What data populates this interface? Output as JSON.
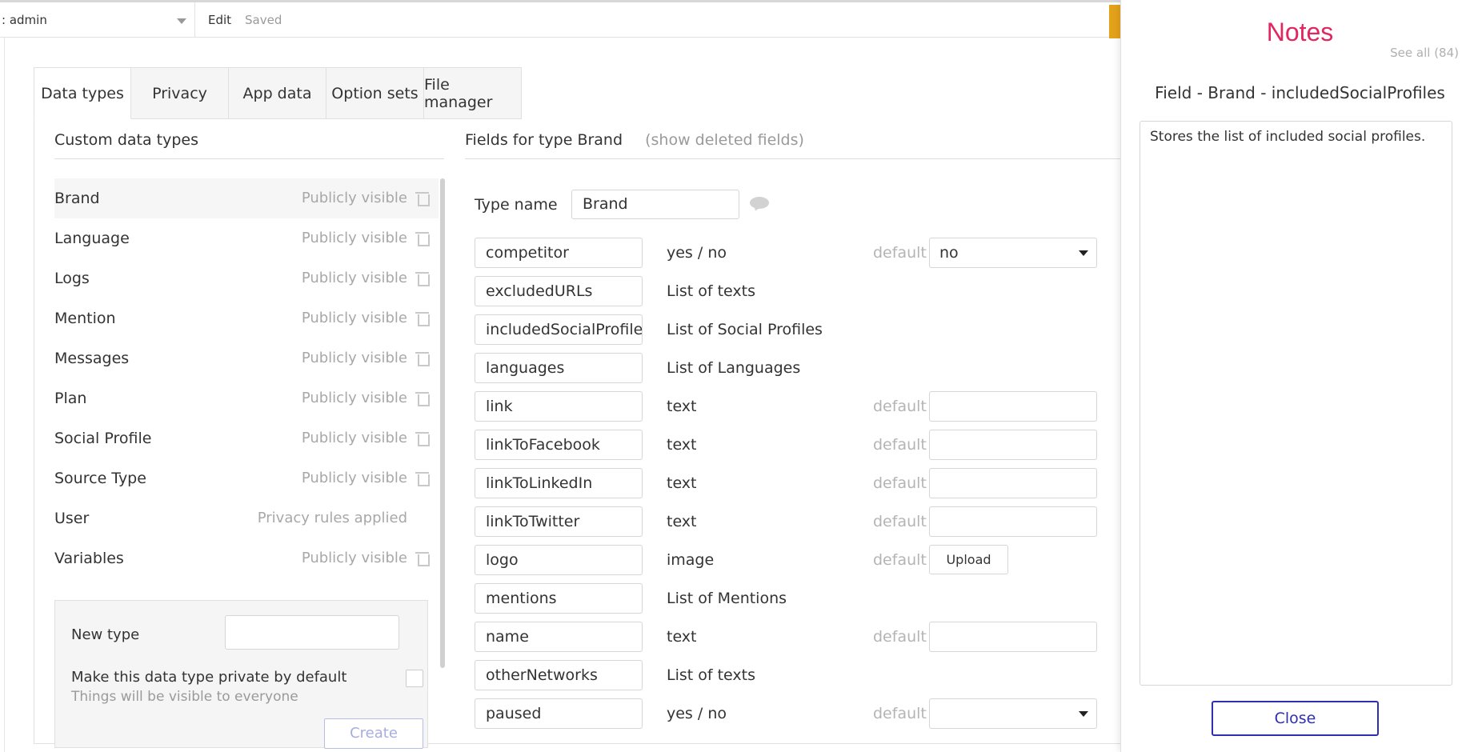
{
  "topbar": {
    "app_selector": ": admin",
    "edit_label": "Edit",
    "status_label": "Saved"
  },
  "tabs": [
    {
      "label": "Data types",
      "active": true
    },
    {
      "label": "Privacy",
      "active": false
    },
    {
      "label": "App data",
      "active": false
    },
    {
      "label": "Option sets",
      "active": false
    },
    {
      "label": "File manager",
      "active": false
    }
  ],
  "custom_types": {
    "header": "Custom data types",
    "items": [
      {
        "name": "Brand",
        "visibility": "Publicly visible",
        "selected": true,
        "deletable": true
      },
      {
        "name": "Language",
        "visibility": "Publicly visible",
        "selected": false,
        "deletable": true
      },
      {
        "name": "Logs",
        "visibility": "Publicly visible",
        "selected": false,
        "deletable": true
      },
      {
        "name": "Mention",
        "visibility": "Publicly visible",
        "selected": false,
        "deletable": true
      },
      {
        "name": "Messages",
        "visibility": "Publicly visible",
        "selected": false,
        "deletable": true
      },
      {
        "name": "Plan",
        "visibility": "Publicly visible",
        "selected": false,
        "deletable": true
      },
      {
        "name": "Social Profile",
        "visibility": "Publicly visible",
        "selected": false,
        "deletable": true
      },
      {
        "name": "Source Type",
        "visibility": "Publicly visible",
        "selected": false,
        "deletable": true
      },
      {
        "name": "User",
        "visibility": "Privacy rules applied",
        "selected": false,
        "deletable": false
      },
      {
        "name": "Variables",
        "visibility": "Publicly visible",
        "selected": false,
        "deletable": true
      }
    ],
    "new_type": {
      "label": "New type",
      "value": "",
      "private_label": "Make this data type private by default",
      "private_sub": "Things will be visible to everyone",
      "private_checked": false,
      "create_label": "Create"
    }
  },
  "fields_panel": {
    "header": "Fields for type Brand",
    "show_deleted": "(show deleted fields)",
    "type_name_label": "Type name",
    "type_name_value": "Brand",
    "default_label": "default",
    "upload_label": "Upload",
    "fields": [
      {
        "name": "competitor",
        "type": "yes / no",
        "default_kind": "dropdown",
        "default_value": "no"
      },
      {
        "name": "excludedURLs",
        "type": "List of texts",
        "default_kind": "none",
        "default_value": ""
      },
      {
        "name": "includedSocialProfiles",
        "type": "List of Social Profiles",
        "default_kind": "none",
        "default_value": ""
      },
      {
        "name": "languages",
        "type": "List of Languages",
        "default_kind": "none",
        "default_value": ""
      },
      {
        "name": "link",
        "type": "text",
        "default_kind": "text",
        "default_value": ""
      },
      {
        "name": "linkToFacebook",
        "type": "text",
        "default_kind": "text",
        "default_value": ""
      },
      {
        "name": "linkToLinkedIn",
        "type": "text",
        "default_kind": "text",
        "default_value": ""
      },
      {
        "name": "linkToTwitter",
        "type": "text",
        "default_kind": "text",
        "default_value": ""
      },
      {
        "name": "logo",
        "type": "image",
        "default_kind": "upload",
        "default_value": ""
      },
      {
        "name": "mentions",
        "type": "List of Mentions",
        "default_kind": "none",
        "default_value": ""
      },
      {
        "name": "name",
        "type": "text",
        "default_kind": "text",
        "default_value": ""
      },
      {
        "name": "otherNetworks",
        "type": "List of texts",
        "default_kind": "none",
        "default_value": ""
      },
      {
        "name": "paused",
        "type": "yes / no",
        "default_kind": "dropdown",
        "default_value": ""
      }
    ]
  },
  "notes": {
    "title": "Notes",
    "see_all": "See all (84)",
    "field_title": "Field - Brand - includedSocialProfiles",
    "body": "Stores the list of included social profiles.",
    "close_label": "Close"
  },
  "colors": {
    "notes_title": "#e2265f",
    "close_button": "#2d2fb0",
    "accent_yellow": "#e3a21a"
  }
}
